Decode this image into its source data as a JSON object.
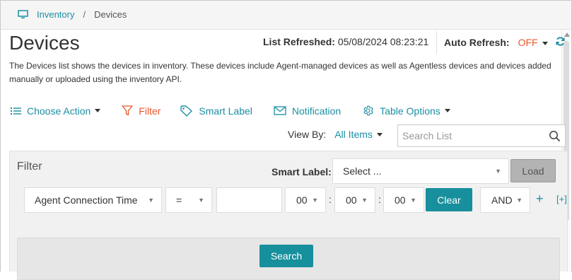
{
  "breadcrumb": {
    "home_label": "Inventory",
    "separator": "/",
    "current": "Devices"
  },
  "page": {
    "title": "Devices",
    "description": "The Devices list shows the devices in inventory. These devices include Agent-managed devices as well as Agentless devices and devices added manually or uploaded using the inventory API."
  },
  "refresh": {
    "list_refreshed_label": "List Refreshed:",
    "list_refreshed_value": "05/08/2024 08:23:21",
    "auto_refresh_label": "Auto Refresh:",
    "auto_refresh_value": "OFF"
  },
  "toolbar": {
    "choose_action": "Choose Action",
    "filter": "Filter",
    "smart_label": "Smart Label",
    "notification": "Notification",
    "table_options": "Table Options"
  },
  "view": {
    "label": "View By:",
    "value": "All Items"
  },
  "search": {
    "placeholder": "Search List"
  },
  "filter_panel": {
    "title": "Filter",
    "smart_label_label": "Smart Label:",
    "smart_label_value": "Select ...",
    "load_label": "Load",
    "field_value": "Agent Connection Time",
    "operator_value": "=",
    "date_value": "",
    "hour_value": "00",
    "minute_value": "00",
    "second_value": "00",
    "time_separator": ":",
    "clear_label": "Clear",
    "conjunction_value": "AND",
    "add_label": "+",
    "add_group_label": "[+]",
    "search_label": "Search"
  },
  "colors": {
    "accent": "#1a8fa3",
    "filter_active": "#e8572a",
    "off": "#e8572a",
    "button_teal": "#178f9c"
  },
  "icons": {
    "breadcrumb": "monitor-icon",
    "auto_refresh": "sync-icon",
    "choose_action": "list-icon",
    "filter": "funnel-icon",
    "smart_label": "tag-icon",
    "notification": "envelope-icon",
    "table_options": "gear-icon",
    "search": "search-icon"
  }
}
